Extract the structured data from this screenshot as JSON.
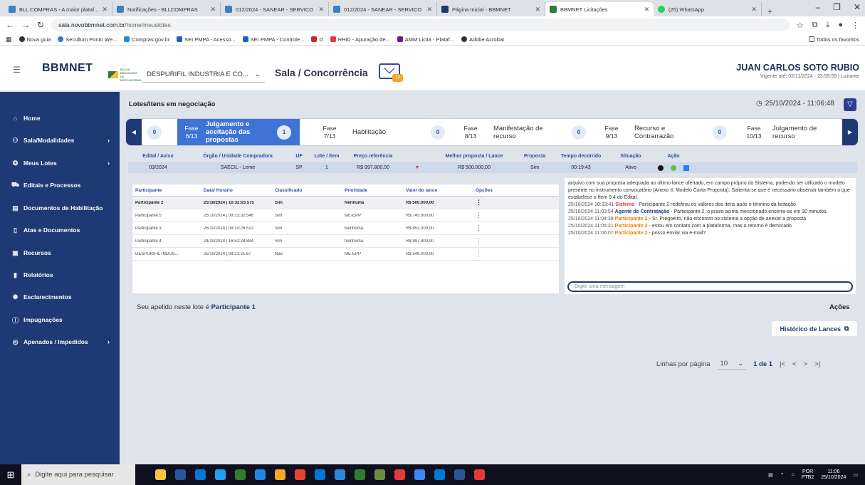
{
  "browser": {
    "tabs": [
      {
        "title": "BLL COMPRAS - A maior plataf...",
        "color": "#3b82c4"
      },
      {
        "title": "Notificações - BLLCOMPRAS",
        "color": "#3b82c4"
      },
      {
        "title": "012/2024 - SANEAR - SERVICO",
        "color": "#3b82c4"
      },
      {
        "title": "012/2024 - SANEAR - SERVICO",
        "color": "#3b82c4"
      },
      {
        "title": "Página Inicial - BBMNET",
        "color": "#1e3a74"
      },
      {
        "title": "BBMNET Licitações",
        "color": "#2e7d32"
      },
      {
        "title": "(25) WhatsApp",
        "color": "#25d366"
      }
    ],
    "url_domain": "sala.novobbmnet.com.br",
    "url_path": "/home/meuslotes",
    "bookmarks": [
      {
        "label": "Nova guia",
        "color": "#333"
      },
      {
        "label": "Secullum Ponto We...",
        "color": "#2a7bd4"
      },
      {
        "label": "Compras.gov.br",
        "color": "#1e88e5"
      },
      {
        "label": "SEI PMPA - Acesso...",
        "color": "#1565c0"
      },
      {
        "label": "SEI PMPA - Controle...",
        "color": "#1565c0"
      },
      {
        "label": "D",
        "color": "#c62828"
      },
      {
        "label": "RHiD - Apuração de...",
        "color": "#e53935"
      },
      {
        "label": "AMM Licita - Plataf...",
        "color": "#6a1b9a"
      },
      {
        "label": "Adobe Acrobat",
        "color": "#333"
      }
    ],
    "bookmarks_all": "Todos os favoritos"
  },
  "header": {
    "logo": "BBMNET",
    "bbm_text": "BOLSA BRASILEIRA DE MERCADORIAS",
    "company": "DESPURIFIL INDUSTRIA E CO...",
    "title": "Sala / Concorrência",
    "mail_badge": "13",
    "user_name": "JUAN CARLOS SOTO RUBIO",
    "user_valid": "Vigente até: 02/11/2024 - 23:59:59 | Licitante"
  },
  "sidebar": {
    "items": [
      {
        "label": "Home",
        "icon": "⌂",
        "chev": ""
      },
      {
        "label": "Sala/Modalidades",
        "icon": "⚇",
        "chev": "›"
      },
      {
        "label": "Meus Lotes",
        "icon": "❂",
        "chev": "›"
      },
      {
        "label": "Editais e Processos",
        "icon": "⛟",
        "chev": ""
      },
      {
        "label": "Documentos de Habilitação",
        "icon": "▤",
        "chev": ""
      },
      {
        "label": "Atas e Documentos",
        "icon": "▯",
        "chev": ""
      },
      {
        "label": "Recursos",
        "icon": "▣",
        "chev": ""
      },
      {
        "label": "Relatórios",
        "icon": "▮",
        "chev": ""
      },
      {
        "label": "Esclarecimentos",
        "icon": "✺",
        "chev": ""
      },
      {
        "label": "Impugnações",
        "icon": "ⓘ",
        "chev": ""
      },
      {
        "label": "Apenados / Impedidos",
        "icon": "◎",
        "chev": "›"
      }
    ]
  },
  "main": {
    "section_title": "Lotes/itens em negociação",
    "datetime": "25/10/2024 - 11:06:48",
    "phases": [
      {
        "num": "0",
        "fase": "Fase",
        "step": "6/13",
        "name": "Julgamento e aceitação das propostas",
        "count": "1"
      },
      {
        "num": "",
        "fase": "Fase",
        "step": "7/13",
        "name": "Habilitação",
        "count": "0"
      },
      {
        "num": "",
        "fase": "Fase",
        "step": "8/13",
        "name": "Manifestação de recurso",
        "count": "0"
      },
      {
        "num": "",
        "fase": "Fase",
        "step": "9/13",
        "name": "Recurso e Contrarrazão",
        "count": "0"
      },
      {
        "num": "",
        "fase": "Fase",
        "step": "10/13",
        "name": "Julgamento de recurso",
        "count": ""
      }
    ],
    "lot_headers": [
      "Edital / Aviso",
      "Órgão / Unidade Compradora",
      "UF",
      "Lote / Item",
      "Preço referência",
      "",
      "Melhor proposta / Lance",
      "Proposta",
      "Tempo decorrido",
      "Situação",
      "Ação"
    ],
    "lot_row": [
      "03/2024",
      "SAECIL - Leme",
      "SP",
      "1",
      "R$ 997.800,00",
      "",
      "R$ 500.000,00",
      "Sim",
      "00:19:43",
      "Ativo",
      ""
    ],
    "part_headers": [
      "Participante",
      "Data/ Horário",
      "Classificado",
      "Prioridade",
      "Valor do lance",
      "Opções"
    ],
    "part_rows": [
      [
        "Participante 2",
        "25/10/2024 | 10:32:03.575",
        "Sim",
        "Nenhuma",
        "R$ 500.000,00",
        "⋮"
      ],
      [
        "Participante 5",
        "25/10/2024 | 09:13:32.546",
        "Sim",
        "ME-EPP",
        "R$ 745.000,00",
        "⋮"
      ],
      [
        "Participante 3",
        "25/10/2024 | 09:10:26.512",
        "Sim",
        "Nenhuma",
        "R$ 952.000,00",
        "⋮"
      ],
      [
        "Participante 4",
        "24/10/2024 | 16:51:28.894",
        "Sim",
        "Nenhuma",
        "R$ 997.800,00",
        "⋮"
      ],
      [
        "DESPURIFIL INDUS...",
        "25/10/2024 | 09:21:21.67",
        "Não",
        "ME-EPP",
        "R$ 549.000,00",
        "⋮"
      ]
    ],
    "nickname_prefix": "Seu apelido neste lote é",
    "nickname": "Participante 1",
    "chat": {
      "intro": "arquivo com sua proposta adequada ao último lance ofertado, em campo próprio do Sistema, podendo ser utilizado o modelo presente no instrumento convocatório (Anexo II: Modelo Carta-Proposta). Salienta-se que é necessário observar também o que estabelece o Item 9.4 do Edital.",
      "m1_ts": "25/10/2024 10:33:41",
      "m1_who": "Sistema",
      "m1_text": " - Participante 2 redefiniu os valores dos itens após o término da licitação",
      "m2_ts": "25/10/2024 11:03:54",
      "m2_who": "Agente de Contratação",
      "m2_text": " - Participante 2, o prazo acima mencionado encerra-se em 30 minutos.",
      "m3_ts": "25/10/2024 11:04:38",
      "m3_who": "Participante 2",
      "m3_text": " - Sr. Pregoeiro, não encontro no sistema a opção de anexar a proposta",
      "m4_ts": "25/10/2024 11:05:21",
      "m4_who": "Participante 2",
      "m4_text": " - estou em contato com a plataforma, mas o retorno é demorado",
      "m5_ts": "25/10/2024 11:06:07",
      "m5_who": "Participante 2",
      "m5_text": " - posso enviar via e-mail?",
      "placeholder": "Digite uma mensagem"
    },
    "acoes": "Ações",
    "historico": "Histórico de Lances",
    "pager": {
      "label": "Linhas por página",
      "value": "10",
      "pages": "1 de 1"
    }
  },
  "taskbar": {
    "search": "Digite aqui para pesquisar",
    "lang1": "POR",
    "lang2": "PTB2",
    "time": "11:06",
    "date": "25/10/2024",
    "icons": [
      "#f5c542",
      "#2b579a",
      "#0078d7",
      "#1da1f2",
      "#2e7d32",
      "#1e88e5",
      "#f5a623",
      "#ea4335",
      "#0078d7",
      "#2b88d8",
      "#2e7d32",
      "#6d8c3e",
      "#e53935",
      "#4285f4",
      "#0078d7",
      "#2b579a",
      "#e53935"
    ]
  }
}
